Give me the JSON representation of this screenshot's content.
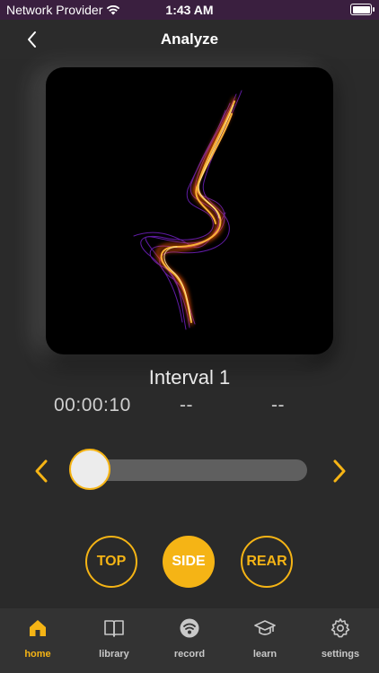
{
  "status_bar": {
    "carrier": "Network Provider",
    "time": "1:43 AM"
  },
  "header": {
    "title": "Analyze",
    "back_icon": "chevron-left-icon"
  },
  "visualization": {
    "description_icon": "motion-trace-heatmap"
  },
  "interval": {
    "label": "Interval 1",
    "time": "00:00:10",
    "stat_2": "--",
    "stat_3": "--"
  },
  "slider": {
    "value": 0,
    "prev_icon": "chevron-left-icon",
    "next_icon": "chevron-right-icon"
  },
  "view_buttons": [
    {
      "label": "TOP",
      "selected": false
    },
    {
      "label": "SIDE",
      "selected": true
    },
    {
      "label": "REAR",
      "selected": false
    }
  ],
  "tabs": [
    {
      "label": "home",
      "icon": "home-icon",
      "active": true
    },
    {
      "label": "library",
      "icon": "book-icon",
      "active": false
    },
    {
      "label": "record",
      "icon": "record-icon",
      "active": false
    },
    {
      "label": "learn",
      "icon": "graduation-cap-icon",
      "active": false
    },
    {
      "label": "settings",
      "icon": "gear-icon",
      "active": false
    }
  ],
  "colors": {
    "accent": "#f5b415",
    "background": "#2b2b2b",
    "status_bar": "#3a1f3f",
    "tab_bar": "#333333"
  }
}
